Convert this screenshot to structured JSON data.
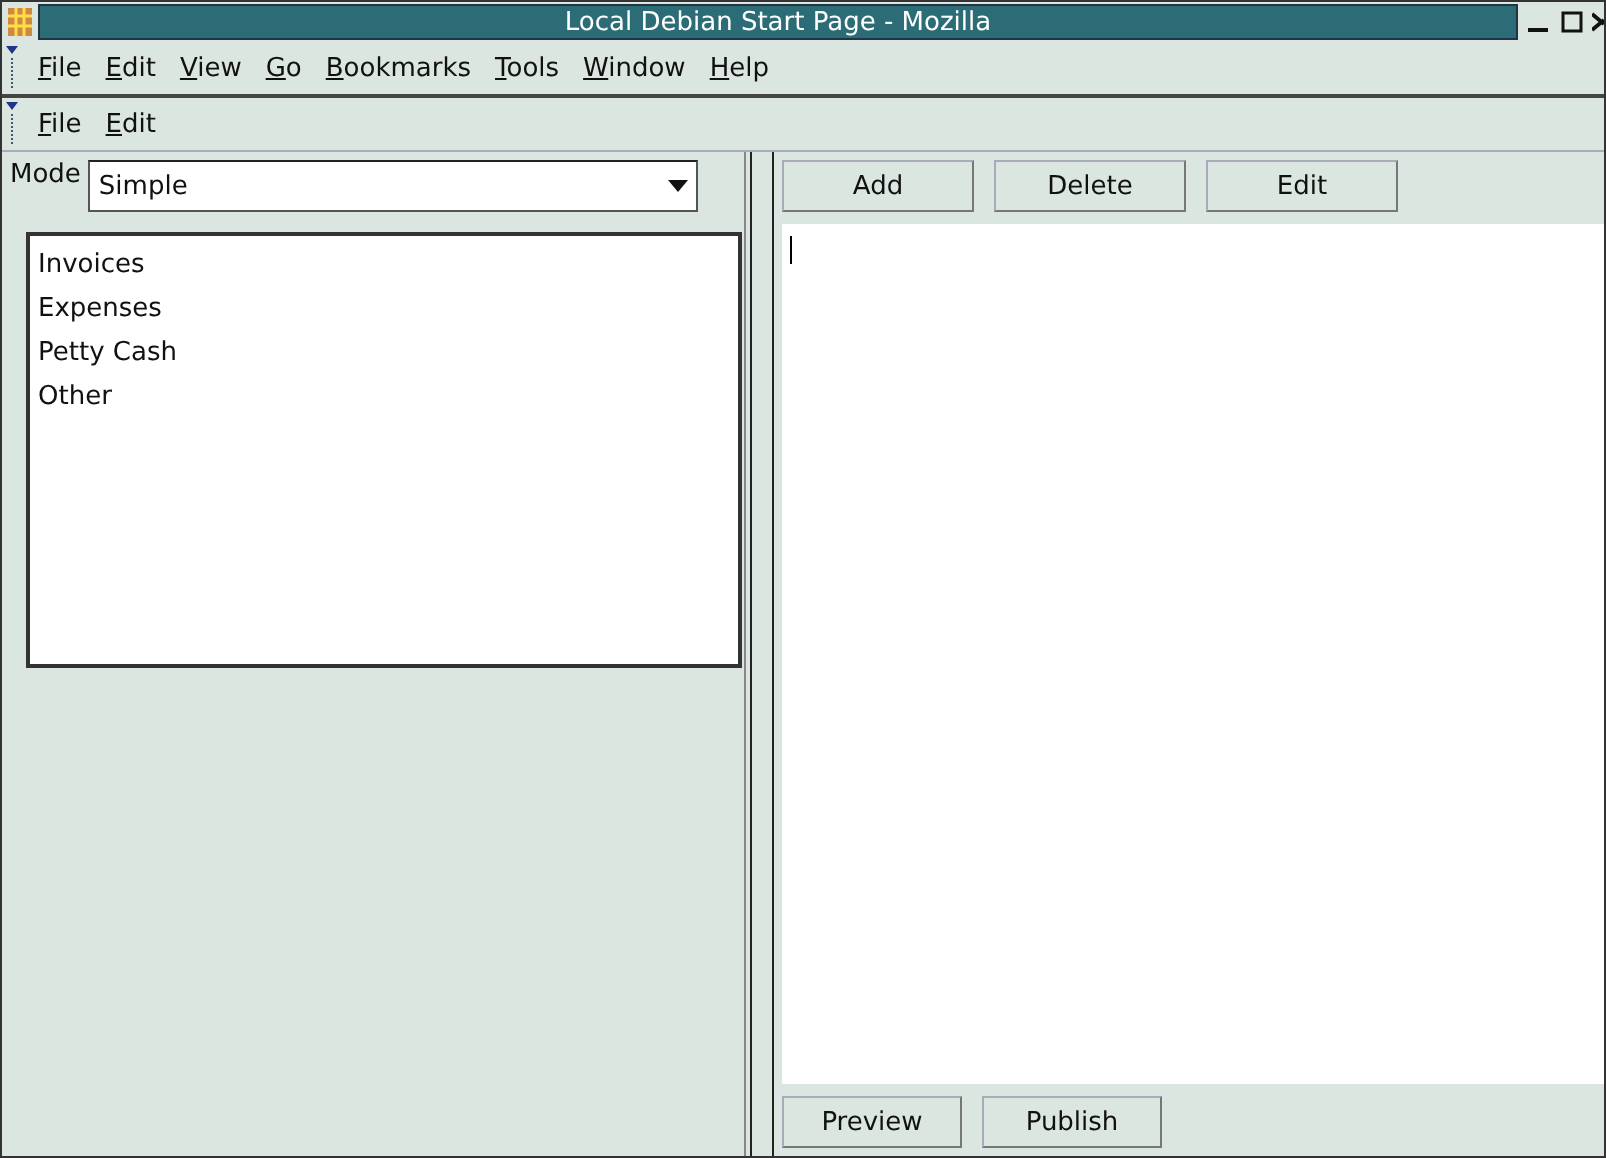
{
  "window": {
    "title": "Local Debian Start Page - Mozilla"
  },
  "menubar": [
    "File",
    "Edit",
    "View",
    "Go",
    "Bookmarks",
    "Tools",
    "Window",
    "Help"
  ],
  "submenu": [
    "File",
    "Edit"
  ],
  "mode": {
    "label": "Mode",
    "value": "Simple"
  },
  "list": [
    "Invoices",
    "Expenses",
    "Petty Cash",
    "Other"
  ],
  "top_buttons": [
    "Add",
    "Delete",
    "Edit"
  ],
  "bottom_buttons": [
    "Preview",
    "Publish"
  ]
}
